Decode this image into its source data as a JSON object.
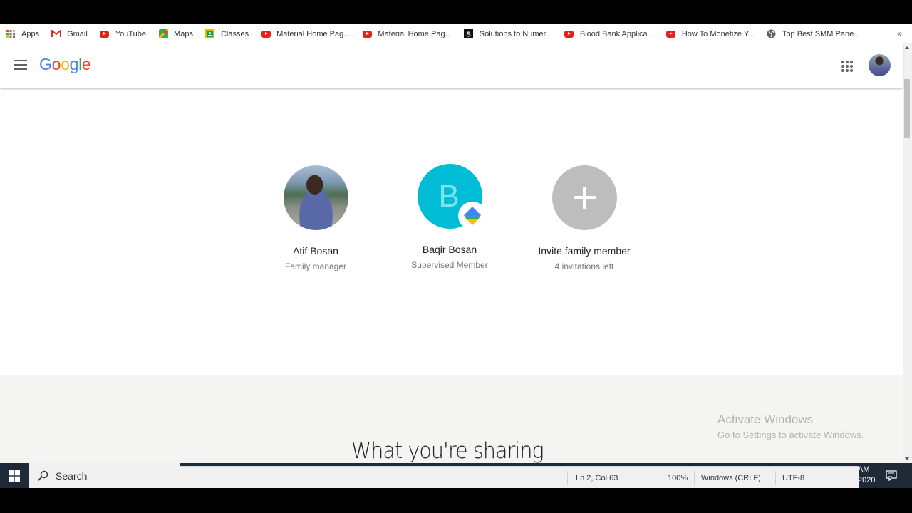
{
  "bookmarks": [
    {
      "label": "Apps",
      "icon": "apps-grid-icon"
    },
    {
      "label": "Gmail",
      "icon": "gmail-icon"
    },
    {
      "label": "YouTube",
      "icon": "youtube-icon"
    },
    {
      "label": "Maps",
      "icon": "maps-icon"
    },
    {
      "label": "Classes",
      "icon": "classes-icon"
    },
    {
      "label": "Material Home Pag...",
      "icon": "youtube-icon"
    },
    {
      "label": "Material Home Pag...",
      "icon": "youtube-icon"
    },
    {
      "label": "Solutions to Numer...",
      "icon": "scribd-icon"
    },
    {
      "label": "Blood Bank Applica...",
      "icon": "youtube-icon"
    },
    {
      "label": "How To Monetize Y...",
      "icon": "youtube-icon"
    },
    {
      "label": "Top Best SMM Pane...",
      "icon": "globe-icon"
    }
  ],
  "bookmarks_more": "»",
  "header": {
    "logo_letters": [
      {
        "ch": "G",
        "color": "#4285F4"
      },
      {
        "ch": "o",
        "color": "#EA4335"
      },
      {
        "ch": "o",
        "color": "#FBBC05"
      },
      {
        "ch": "g",
        "color": "#4285F4"
      },
      {
        "ch": "l",
        "color": "#34A853"
      },
      {
        "ch": "e",
        "color": "#EA4335"
      }
    ]
  },
  "members": [
    {
      "name": "Atif Bosan",
      "role": "Family manager"
    },
    {
      "name": "Baqir Bosan",
      "role": "Supervised Member",
      "initial": "B"
    },
    {
      "name": "Invite family member",
      "role": "4 invitations left"
    }
  ],
  "sharing": {
    "title": "What you're sharing"
  },
  "watermark": {
    "line1": "Activate Windows",
    "line2": "Go to Settings to activate Windows."
  },
  "taskbar": {
    "search_label": "Search",
    "status": {
      "position": "Ln 2, Col 63",
      "zoom": "100%",
      "line_ending": "Windows (CRLF)",
      "encoding": "UTF-8"
    },
    "time": "AM",
    "date": "2020"
  }
}
